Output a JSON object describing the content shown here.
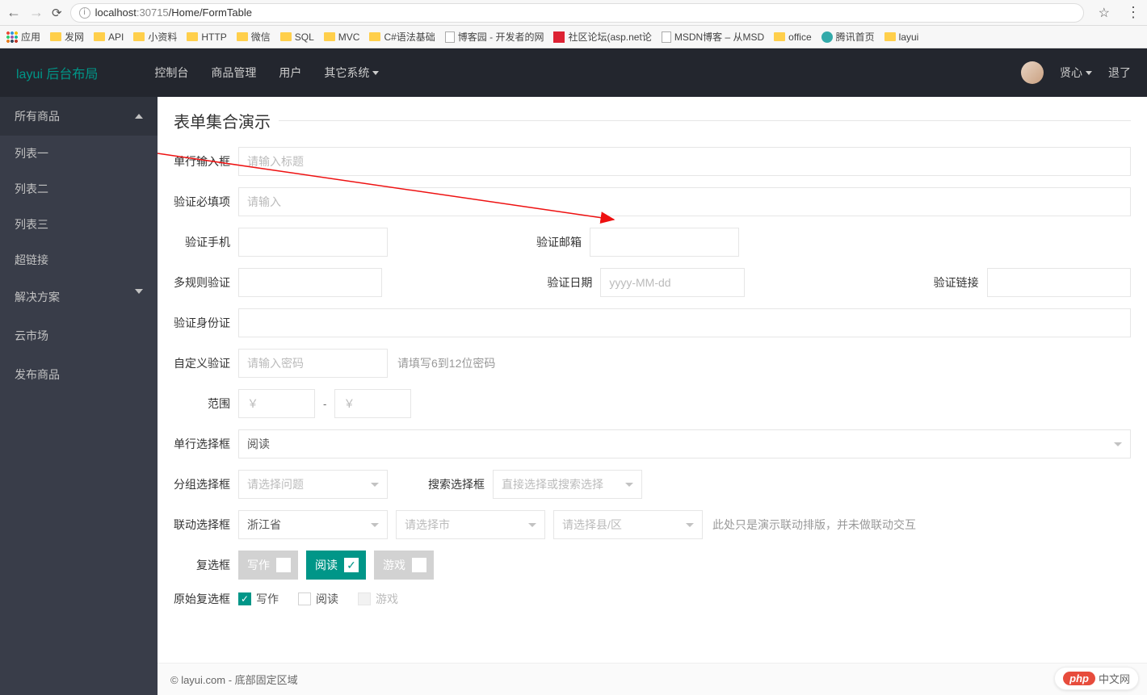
{
  "browser": {
    "url_host": "localhost",
    "url_port": ":30715",
    "url_path": "/Home/FormTable",
    "apps_label": "应用",
    "bookmarks": [
      {
        "type": "folder",
        "label": "发网"
      },
      {
        "type": "folder",
        "label": "API"
      },
      {
        "type": "folder",
        "label": "小资料"
      },
      {
        "type": "folder",
        "label": "HTTP"
      },
      {
        "type": "folder",
        "label": "微信"
      },
      {
        "type": "folder",
        "label": "SQL"
      },
      {
        "type": "folder",
        "label": "MVC"
      },
      {
        "type": "folder",
        "label": "C#语法基础"
      },
      {
        "type": "page",
        "label": "博客园 - 开发者的网"
      },
      {
        "type": "red",
        "label": "社区论坛(asp.net论"
      },
      {
        "type": "page",
        "label": "MSDN博客 – 从MSD"
      },
      {
        "type": "folder",
        "label": "office"
      },
      {
        "type": "circle",
        "label": "腾讯首页"
      },
      {
        "type": "folder",
        "label": "layui"
      }
    ]
  },
  "header": {
    "logo": "layui 后台布局",
    "nav": [
      "控制台",
      "商品管理",
      "用户"
    ],
    "nav_dropdown": "其它系统",
    "user": "贤心",
    "logout": "退了"
  },
  "sidebar": {
    "all_products": "所有商品",
    "list1": "列表一",
    "list2": "列表二",
    "list3": "列表三",
    "hyperlink": "超链接",
    "solution": "解决方案",
    "cloud": "云市场",
    "publish": "发布商品"
  },
  "page": {
    "legend": "表单集合演示",
    "single_input": "单行输入框",
    "single_input_ph": "请输入标题",
    "required": "验证必填项",
    "required_ph": "请输入",
    "phone": "验证手机",
    "email": "验证邮箱",
    "multi_rule": "多规则验证",
    "date": "验证日期",
    "date_ph": "yyyy-MM-dd",
    "link": "验证链接",
    "idcard": "验证身份证",
    "custom": "自定义验证",
    "custom_ph": "请输入密码",
    "custom_tip": "请填写6到12位密码",
    "range": "范围",
    "range_ph": "￥",
    "single_select": "单行选择框",
    "single_select_val": "阅读",
    "group_select": "分组选择框",
    "group_select_val": "请选择问题",
    "search_select_lbl": "搜索选择框",
    "search_select_val": "直接选择或搜索选择",
    "link_select": "联动选择框",
    "link_sel_province": "浙江省",
    "link_sel_city": "请选择市",
    "link_sel_county": "请选择县/区",
    "link_tip": "此处只是演示联动排版，并未做联动交互",
    "checkbox": "复选框",
    "chk_write": "写作",
    "chk_read": "阅读",
    "chk_game": "游戏",
    "raw_checkbox": "原始复选框",
    "footer": "© layui.com - 底部固定区域",
    "php_cn": "中文网",
    "php_logo": "php"
  }
}
